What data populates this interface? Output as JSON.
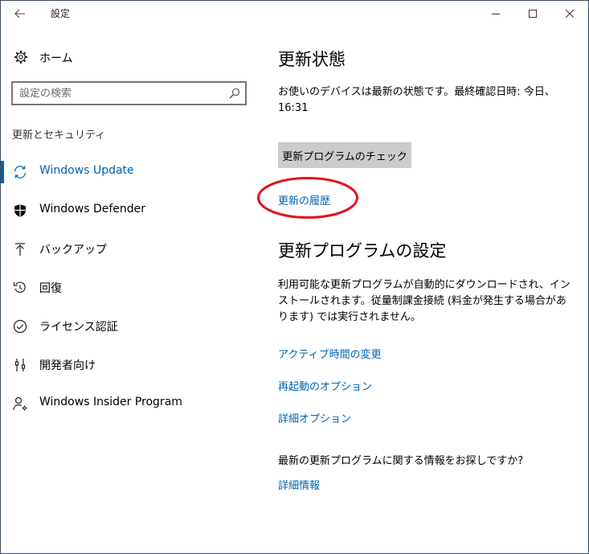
{
  "titlebar": {
    "title": "設定"
  },
  "sidebar": {
    "home_label": "ホーム",
    "search_placeholder": "設定の検索",
    "section_heading": "更新とセキュリティ",
    "items": [
      {
        "label": "Windows Update",
        "icon": "sync-icon",
        "selected": true
      },
      {
        "label": "Windows Defender",
        "icon": "shield-icon",
        "selected": false
      },
      {
        "label": "バックアップ",
        "icon": "backup-arrow-icon",
        "selected": false
      },
      {
        "label": "回復",
        "icon": "recovery-icon",
        "selected": false
      },
      {
        "label": "ライセンス認証",
        "icon": "activation-check-icon",
        "selected": false
      },
      {
        "label": "開発者向け",
        "icon": "developer-tools-icon",
        "selected": false
      },
      {
        "label": "Windows Insider Program",
        "icon": "insider-person-icon",
        "selected": false
      }
    ]
  },
  "main": {
    "status": {
      "heading": "更新状態",
      "message": "お使いのデバイスは最新の状態です。最終確認日時: 今日、16:31",
      "check_button": "更新プログラムのチェック",
      "history_link": "更新の履歴"
    },
    "settings": {
      "heading": "更新プログラムの設定",
      "description": "利用可能な更新プログラムが自動的にダウンロードされ、インストールされます。従量制課金接続 (料金が発生する場合があります) では実行されません。",
      "links": [
        "アクティブ時間の変更",
        "再起動のオプション",
        "詳細オプション"
      ]
    },
    "info": {
      "question": "最新の更新プログラムに関する情報をお探しですか?",
      "link": "詳細情報"
    }
  },
  "colors": {
    "accent": "#0063b1",
    "annotation": "#e0141e",
    "button_bg": "#cccccc"
  }
}
